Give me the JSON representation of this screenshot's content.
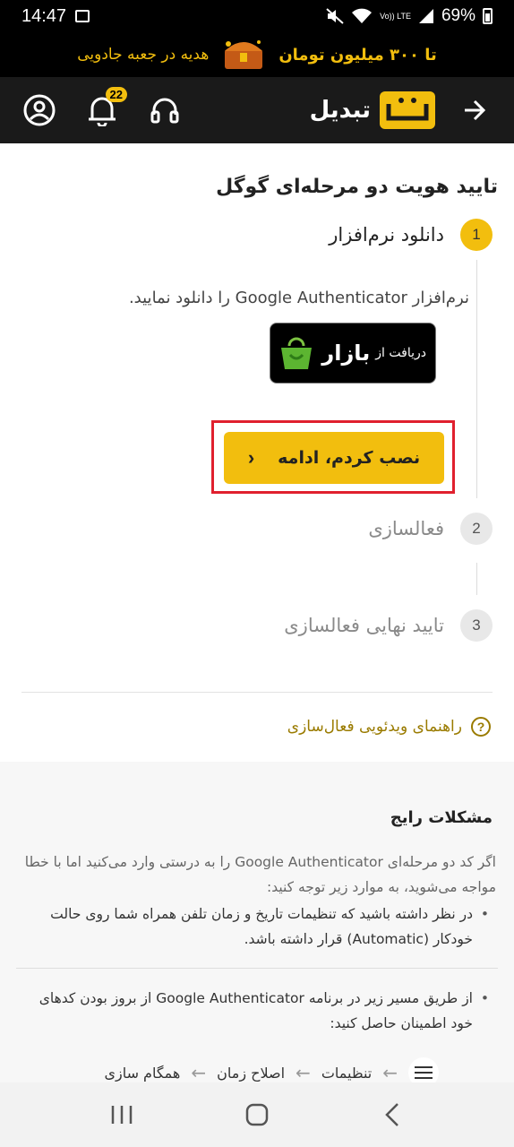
{
  "status_bar": {
    "time": "14:47",
    "battery": "69%",
    "network": "Vo)) LTE"
  },
  "promo": {
    "part1": "تا ۳۰۰ میلیون تومان",
    "part2": "هدیه در جعبه جادویی"
  },
  "header": {
    "brand": "تبدیل",
    "notification_count": "22"
  },
  "page": {
    "title": "تایید هویت دو مرحله‌ای گوگل",
    "steps": [
      {
        "number": "1",
        "label": "دانلود نرم‌افزار"
      },
      {
        "number": "2",
        "label": "فعالسازی"
      },
      {
        "number": "3",
        "label": "تایید نهایی فعالسازی"
      }
    ],
    "step_description": "نرم‌افزار Google Authenticator را دانلود نمایید.",
    "bazaar": {
      "small": "دریافت از",
      "big": "بازار"
    },
    "continue_label": "نصب کردم، ادامه",
    "video_guide": "راهنمای ویدئویی فعال‌سازی"
  },
  "problems": {
    "title": "مشکلات رایج",
    "intro": "اگر کد دو مرحله‌ای Google Authenticator را به درستی وارد می‌کنید اما با خطا مواجه می‌شوید، به موارد زیر توجه کنید:",
    "bullet1": "در نظر داشته باشید که تنظیمات تاریخ و زمان تلفن همراه شما روی حالت خودکار (Automatic) قرار داشته باشد.",
    "bullet2": "از طریق مسیر زیر در برنامه Google Authenticator از بروز بودن کدهای خود اطمینان حاصل کنید:",
    "path": [
      "تنظیمات",
      "اصلاح زمان",
      "همگام سازی"
    ]
  },
  "colors": {
    "accent": "#f2be0e",
    "highlight": "#e0202e",
    "link": "#9a7b00"
  }
}
